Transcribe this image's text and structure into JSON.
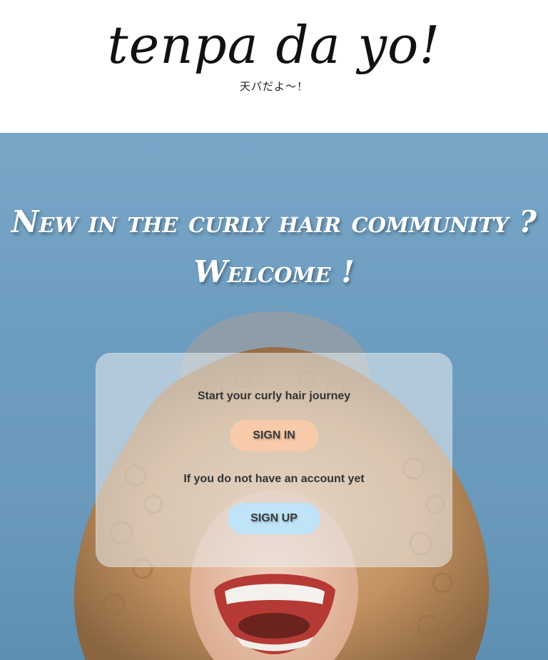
{
  "header": {
    "logo_text": "tenpa da yo!",
    "logo_subtitle": "天パだよ～！"
  },
  "hero": {
    "title_line1": "New in the curly hair community ?",
    "title_line2": "Welcome !",
    "background_image": "woman-with-curly-hair-laughing"
  },
  "card": {
    "prompt_signin": "Start your curly hair journey",
    "signin_label": "SIGN IN",
    "prompt_signup": "If you do not have an account yet",
    "signup_label": "SIGN UP"
  },
  "colors": {
    "sky": "#6d9dc0",
    "signin_button": "#f7cba9",
    "signup_button": "#bfe3f7",
    "card": "#ebeef0",
    "text_dark": "#333333"
  }
}
